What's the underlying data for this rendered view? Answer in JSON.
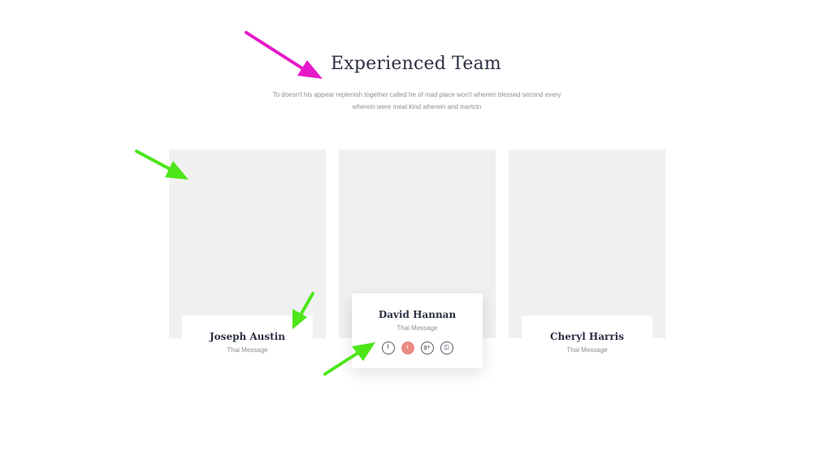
{
  "section": {
    "title": "Experienced Team",
    "description": "To doesn't his appear replenish together called he of mad place won't wherein blessed second every wherein were meat kind wherein and martcin"
  },
  "team": [
    {
      "name": "Joseph Austin",
      "role": "Thai Message"
    },
    {
      "name": "David Hannan",
      "role": "Thai Message",
      "social": [
        {
          "icon": "facebook-icon",
          "glyph": "f"
        },
        {
          "icon": "twitter-icon",
          "glyph": "t"
        },
        {
          "icon": "google-plus-icon",
          "glyph": "g+"
        },
        {
          "icon": "instagram-icon",
          "glyph": "◫"
        }
      ]
    },
    {
      "name": "Cheryl Harris",
      "role": "Thai Message"
    }
  ],
  "colors": {
    "title": "#2c3142",
    "muted": "#8a8f99",
    "placeholder": "#f0f0f0",
    "social_active": "#ea8a80",
    "arrow_magenta": "#e619c8",
    "arrow_green": "#4ce619"
  }
}
